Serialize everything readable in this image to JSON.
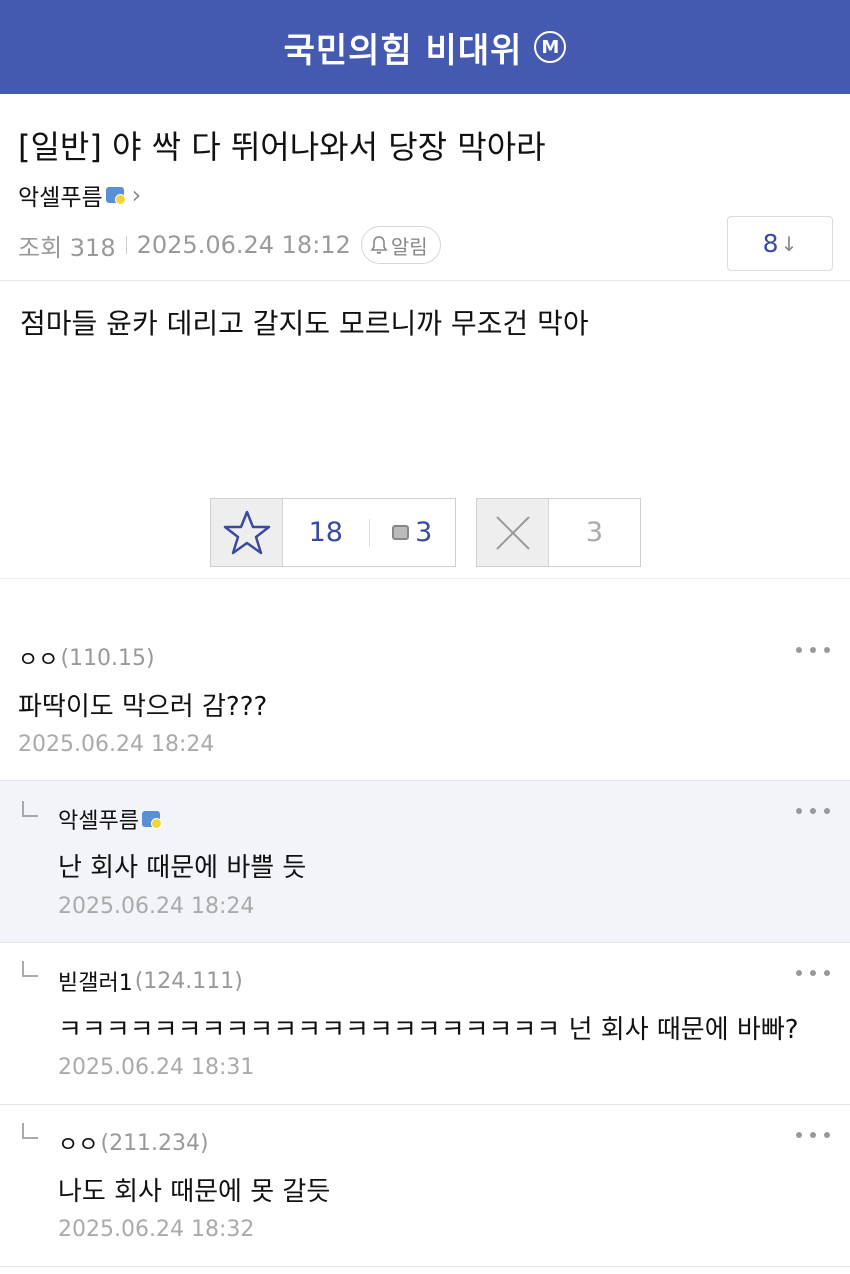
{
  "header": {
    "title": "국민의힘 비대위",
    "badge": "M"
  },
  "post": {
    "title": "[일반] 야 싹 다 뛰어나와서 당장 막아라",
    "author": "악셀푸름",
    "views_label": "조회 318",
    "datetime": "2025.06.24 18:12",
    "alert_label": "알림",
    "comment_count": "8",
    "body": "점마들 윤카 데리고 갈지도 모르니까 무조건 막아",
    "votes": {
      "recommend": "18",
      "fixed": "3",
      "downvote": "3"
    }
  },
  "comments": [
    {
      "name": "ㅇㅇ",
      "ip": "(110.15)",
      "text": "파딱이도 막으러 감???",
      "date": "2025.06.24 18:24"
    },
    {
      "name": "악셀푸름",
      "ip": "",
      "text": "난 회사 때문에 바쁠 듯",
      "date": "2025.06.24 18:24"
    },
    {
      "name": "빋갤러1",
      "ip": "(124.111)",
      "text": "ㅋㅋㅋㅋㅋㅋㅋㅋㅋㅋㅋㅋㅋㅋㅋㅋㅋㅋㅋㅋㅋ 넌 회사 때문에 바빠?",
      "date": "2025.06.24 18:31"
    },
    {
      "name": "ㅇㅇ",
      "ip": "(211.234)",
      "text": "나도 회사 때문에 못 갈듯",
      "date": "2025.06.24 18:32"
    }
  ],
  "colors": {
    "brand": "#4459b0",
    "accent_text": "#3b4aa0",
    "reply_highlight": "#f2f4fa"
  }
}
